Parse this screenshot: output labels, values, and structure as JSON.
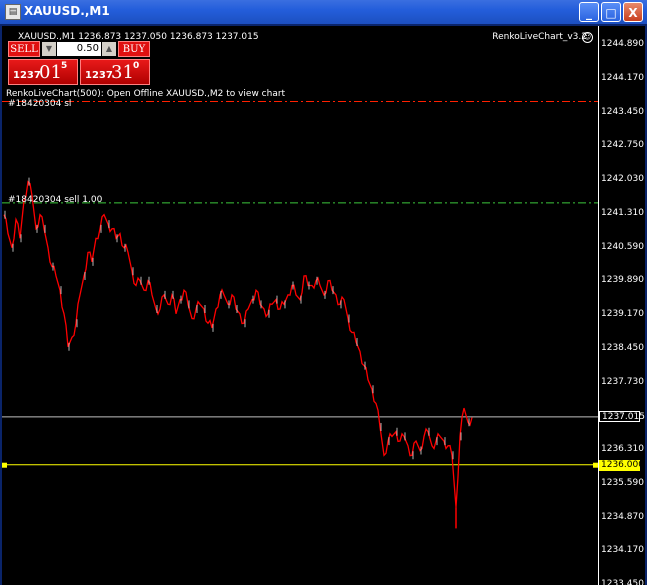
{
  "window": {
    "title": "XAUUSD.,M1",
    "icon": "chart-window-icon",
    "controls": {
      "minimize": "_",
      "maximize": "□",
      "close": "X"
    }
  },
  "chart": {
    "symbol_line": "XAUUSD.,M1  1236.873 1237.050 1236.873 1237.015",
    "indicator_name": "RenkoLiveChart_v3.2",
    "info_line": "RenkoLiveChart(500): Open Offline XAUUSD.,M2 to view chart",
    "order_labels": [
      "#18420304 sl",
      "#18420304 sell 1.00"
    ],
    "price_scale": [
      "1244.890",
      "1244.170",
      "1243.450",
      "1242.750",
      "1242.030",
      "1241.310",
      "1240.590",
      "1239.890",
      "1239.170",
      "1238.450",
      "1237.730",
      "1236.310",
      "1235.590",
      "1234.870",
      "1234.170",
      "1233.450"
    ],
    "bid_tag": "1237.015",
    "line_tag": "1236.000",
    "colors": {
      "background": "#000000",
      "candles": "#ff0000",
      "sl_line": "#ff2000",
      "entry_line": "#3cc83c",
      "bid_line": "#c0c0c0",
      "horizontal_line": "#ffff00"
    }
  },
  "trade_panel": {
    "sell_label": "SELL",
    "buy_label": "BUY",
    "lot": "0.50",
    "sell_price": {
      "prefix": "1237",
      "big": "01",
      "sup": "5"
    },
    "buy_price": {
      "prefix": "1237",
      "big": "31",
      "sup": "0"
    }
  },
  "chart_data": {
    "type": "line",
    "x": [
      0,
      4,
      8,
      12,
      16,
      20,
      24,
      28,
      32,
      36,
      40,
      44,
      48,
      52,
      56,
      60,
      64,
      68,
      72,
      76,
      80,
      84,
      88,
      92,
      96,
      100,
      104,
      108,
      112,
      116,
      120,
      124,
      128,
      132,
      136,
      140,
      144,
      148,
      152,
      156,
      160,
      164,
      168,
      172,
      176,
      180,
      184,
      188,
      192,
      196,
      200,
      204,
      208,
      212,
      216,
      220,
      224,
      228,
      232,
      236,
      240,
      244,
      248,
      252,
      256,
      260,
      264,
      268,
      272,
      276,
      280,
      284,
      288,
      292,
      296,
      300,
      304,
      308,
      312,
      316,
      320,
      324,
      328,
      332,
      336,
      340,
      344,
      348,
      352,
      356,
      360,
      364,
      368,
      372,
      376,
      380,
      384,
      388,
      392,
      396,
      400,
      404,
      408,
      412,
      416,
      420,
      424,
      428,
      432,
      436,
      440,
      444,
      448,
      452,
      456,
      460,
      464,
      468,
      472
    ],
    "values": [
      1241.3,
      1240.9,
      1240.6,
      1241.2,
      1240.8,
      1241.6,
      1242.0,
      1241.7,
      1241.0,
      1241.3,
      1241.0,
      1240.6,
      1240.2,
      1240.0,
      1239.7,
      1239.2,
      1238.5,
      1238.7,
      1239.0,
      1239.6,
      1240.0,
      1240.5,
      1240.3,
      1240.8,
      1241.0,
      1241.3,
      1241.1,
      1241.0,
      1240.8,
      1240.9,
      1240.6,
      1240.5,
      1240.1,
      1239.8,
      1239.9,
      1239.7,
      1239.9,
      1239.6,
      1239.3,
      1239.3,
      1239.6,
      1239.4,
      1239.6,
      1239.2,
      1239.5,
      1239.7,
      1239.4,
      1239.1,
      1239.3,
      1239.4,
      1239.3,
      1239.0,
      1238.9,
      1239.3,
      1239.6,
      1239.6,
      1239.4,
      1239.6,
      1239.3,
      1239.2,
      1239.0,
      1239.3,
      1239.5,
      1239.7,
      1239.4,
      1239.3,
      1239.2,
      1239.4,
      1239.5,
      1239.3,
      1239.4,
      1239.6,
      1239.8,
      1239.6,
      1239.5,
      1240.0,
      1239.8,
      1239.8,
      1239.9,
      1239.8,
      1239.6,
      1239.9,
      1239.7,
      1239.6,
      1239.4,
      1239.5,
      1239.1,
      1238.8,
      1238.6,
      1238.4,
      1238.1,
      1237.8,
      1237.6,
      1237.3,
      1236.8,
      1236.2,
      1236.5,
      1236.6,
      1236.7,
      1236.5,
      1236.6,
      1236.4,
      1236.2,
      1236.5,
      1236.3,
      1236.6,
      1236.7,
      1236.4,
      1236.5,
      1236.6,
      1236.5,
      1236.4,
      1236.2,
      1235.1,
      1236.6,
      1237.2,
      1236.9,
      1237.0
    ],
    "xlabel": "",
    "ylabel": "",
    "ylim": [
      1233.45,
      1245.3
    ],
    "levels": {
      "stop_loss": 1243.7,
      "entry": 1241.55,
      "bid": 1237.015,
      "hline": 1236.0
    },
    "spikes": [
      [
        452,
        1234.65
      ]
    ]
  }
}
